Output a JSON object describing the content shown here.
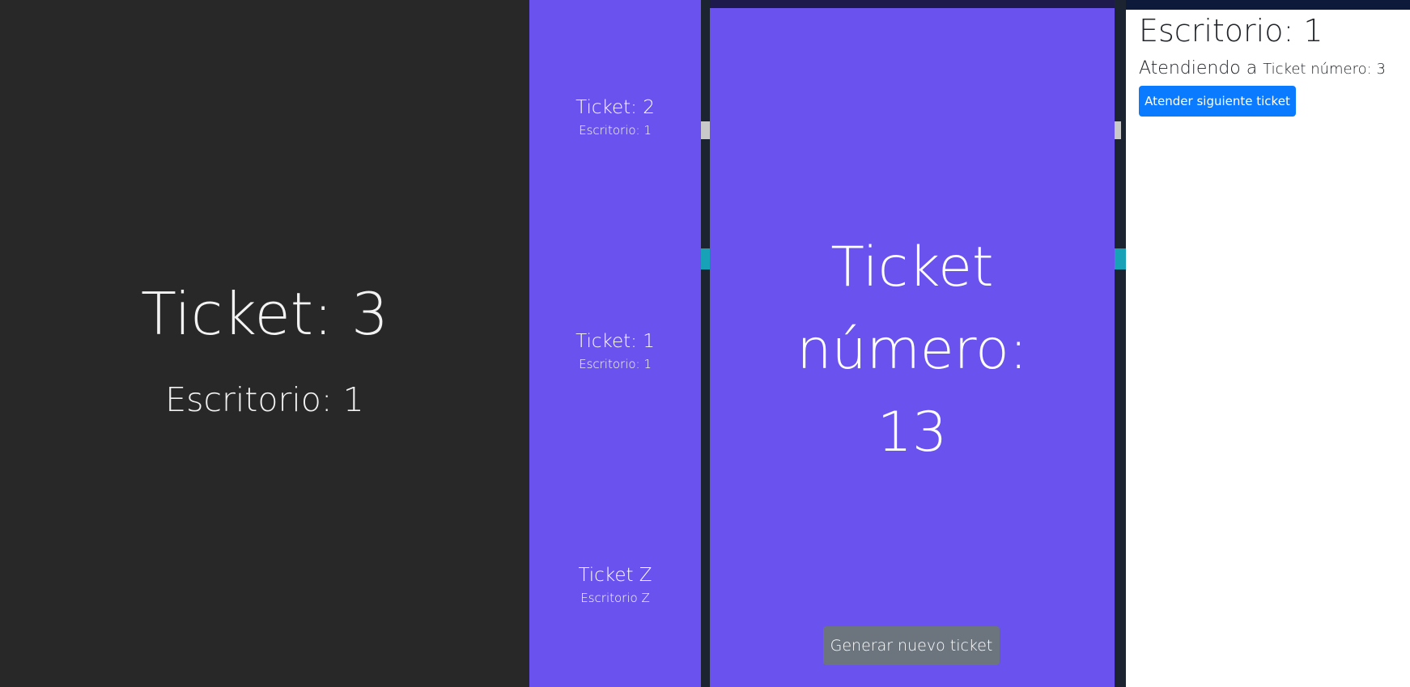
{
  "current": {
    "ticket": "Ticket: 3",
    "desk": "Escritorio: 1"
  },
  "history": [
    {
      "ticket": "Ticket: 2",
      "desk": "Escritorio: 1"
    },
    {
      "ticket": "Ticket: 1",
      "desk": "Escritorio: 1"
    },
    {
      "ticket": "Ticket Z",
      "desk": "Escritorio Z"
    }
  ],
  "new_ticket": {
    "label": "Ticket número:",
    "number": "13",
    "button": "Generar nuevo ticket"
  },
  "desk_screen": {
    "title": "Escritorio: 1",
    "attending_prefix": "Atendiendo a",
    "attending_ticket": "Ticket número: 3",
    "button": "Atender siguiente ticket"
  },
  "colors": {
    "dark_panel": "#282828",
    "purple": "#6a52ee",
    "primary_button": "#0a7bff",
    "secondary_button": "#6c757d"
  }
}
